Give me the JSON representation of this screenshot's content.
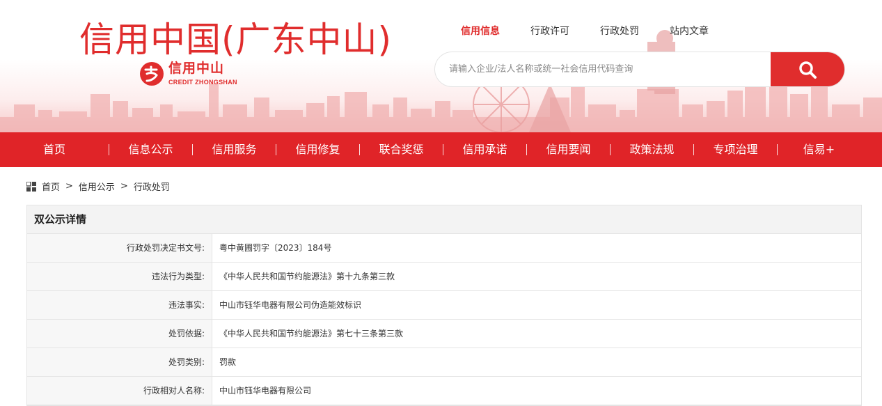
{
  "header": {
    "site_title": "信用中国(广东中山)",
    "logo_text": "信用中山",
    "logo_sub": "CREDIT ZHONGSHAN",
    "top_nav": [
      {
        "label": "信用信息",
        "active": true
      },
      {
        "label": "行政许可",
        "active": false
      },
      {
        "label": "行政处罚",
        "active": false
      },
      {
        "label": "站内文章",
        "active": false
      }
    ],
    "search": {
      "placeholder": "请输入企业/法人名称或统一社会信用代码查询",
      "button_icon": "search-icon"
    }
  },
  "main_nav": [
    "首页",
    "信息公示",
    "信用服务",
    "信用修复",
    "联合奖惩",
    "信用承诺",
    "信用要闻",
    "政策法规",
    "专项治理",
    "信易+"
  ],
  "breadcrumb": {
    "icon": "grid-icon",
    "items": [
      "首页",
      "信用公示",
      "行政处罚"
    ],
    "separator": ">"
  },
  "detail": {
    "title": "双公示详情",
    "rows": [
      {
        "label": "行政处罚决定书文号:",
        "value": "粤中黄圃罚字〔2023〕184号"
      },
      {
        "label": "违法行为类型:",
        "value": "《中华人民共和国节约能源法》第十九条第三款"
      },
      {
        "label": "违法事实:",
        "value": "中山市钰华电器有限公司伪造能效标识"
      },
      {
        "label": "处罚依据:",
        "value": "《中华人民共和国节约能源法》第七十三条第三款"
      },
      {
        "label": "处罚类别:",
        "value": "罚款"
      },
      {
        "label": "行政相对人名称:",
        "value": "中山市钰华电器有限公司"
      }
    ]
  },
  "colors": {
    "brand_red": "#e02d2d",
    "nav_red": "#e02428"
  }
}
